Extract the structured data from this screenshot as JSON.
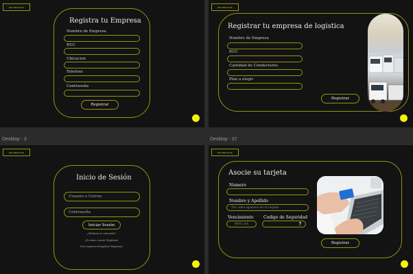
{
  "frames": {
    "bottom_left_label": "Desktop - 3",
    "bottom_right_label": "Desktop - 37"
  },
  "logo_text": "NETSERVICE",
  "register_company": {
    "title": "Registra tu Empresa",
    "fields": [
      "Nombre de Empresa",
      "RUC",
      "Ubicacion",
      "Telefono",
      "Contraseña"
    ],
    "button": "Registrar"
  },
  "register_logistics": {
    "title": "Registrar tu empresa de logistica",
    "fields": [
      "Nombre de Empresa",
      "RUC",
      "Cantidad de Conductores",
      "Plan a elegir"
    ],
    "button": "Registrar",
    "image_label": "trucks-photo"
  },
  "login": {
    "title": "Inicio de Sesión",
    "user_placeholder": "Usuario o Correo",
    "password_placeholder": "Contraseña",
    "button": "Iniciar Sesión",
    "links": [
      "¿Olvidaste tu contraseña?",
      "¿No tienes cuenta? Registrate",
      "Eres empresa de logística? Registrate"
    ]
  },
  "card_link": {
    "title": "Asocie su tarjeta",
    "number_label": "Numero",
    "name_label": "Nombre y Apellido",
    "name_placeholder": "Tal como aparece en la tarjeta",
    "expiry_label": "Vencimiento",
    "expiry_placeholder": "MM / AA",
    "cvv_label": "Codigo de Seguridad",
    "cvv_hint": "?",
    "button": "Registrar",
    "image_label": "laptop-card-photo"
  },
  "colors": {
    "accent": "#8f9a10",
    "dot": "#f2f20d",
    "background": "#131313"
  }
}
